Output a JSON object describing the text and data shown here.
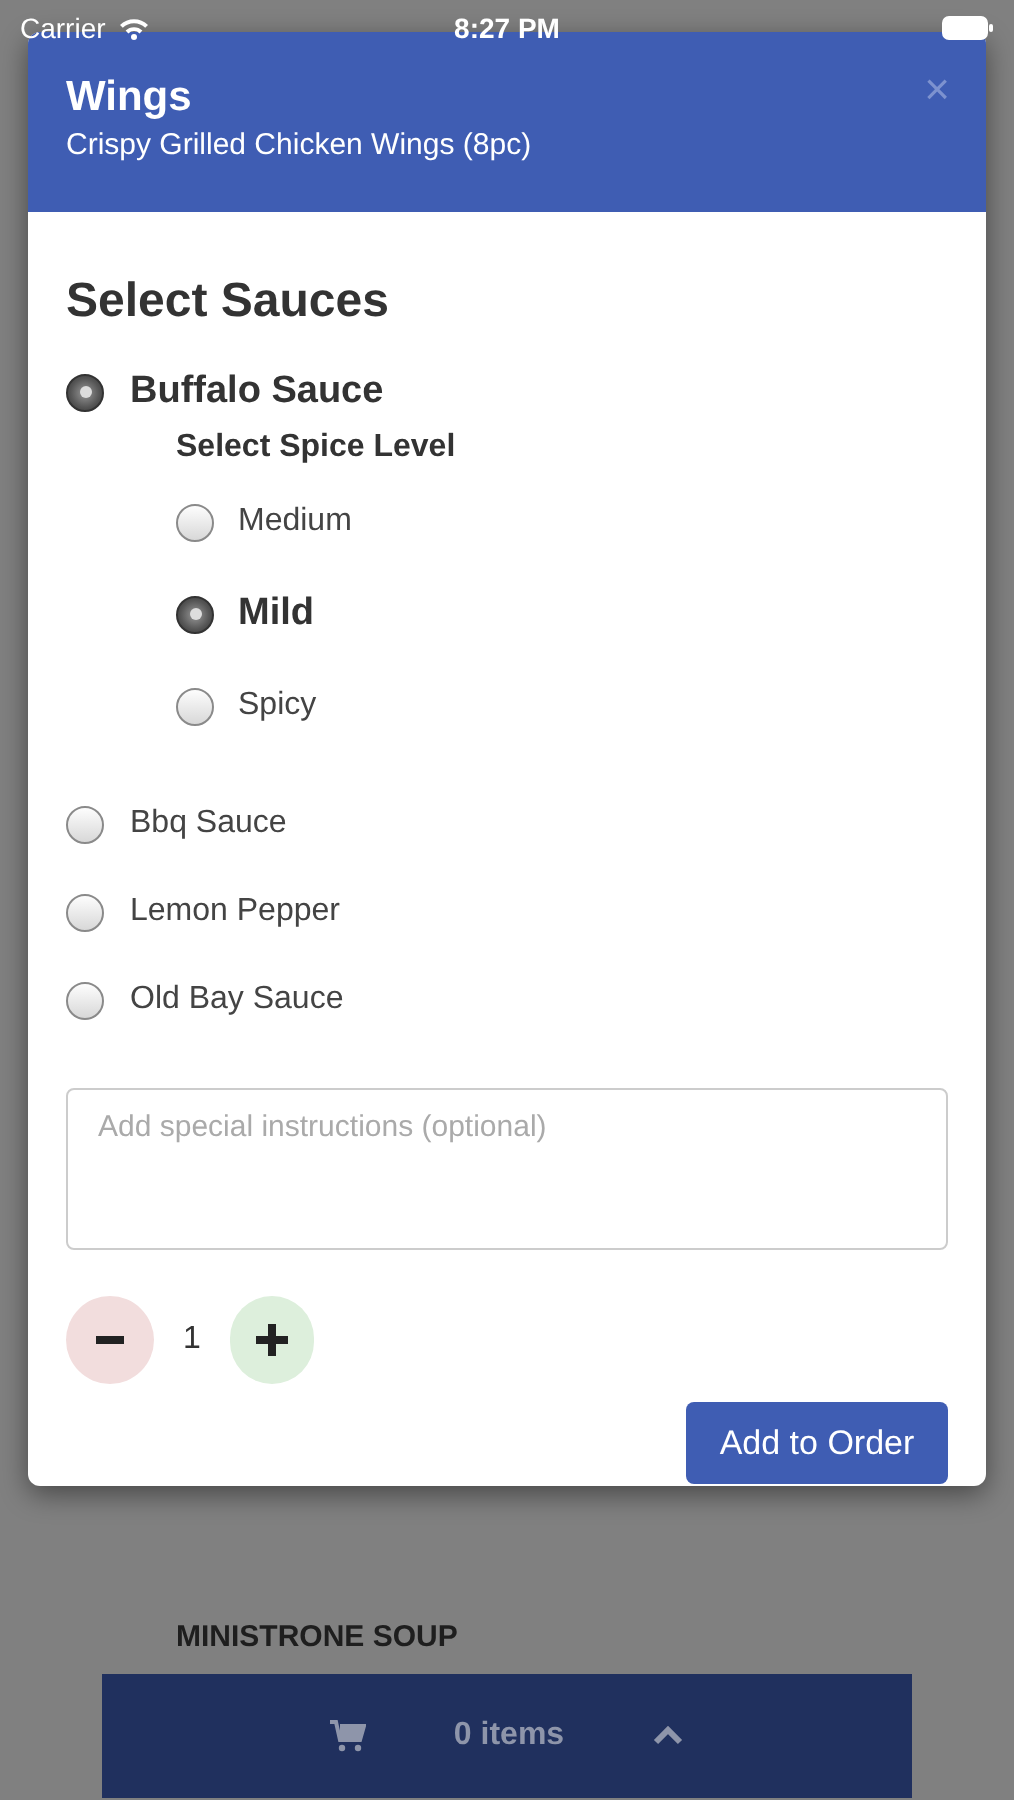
{
  "status_bar": {
    "carrier": "Carrier",
    "time": "8:27 PM"
  },
  "background": {
    "section_title": "MINISTRONE SOUP",
    "cart": {
      "count": "0 items"
    }
  },
  "modal": {
    "title": "Wings",
    "subtitle": "Crispy Grilled Chicken Wings (8pc)",
    "close": "×",
    "heading": "Select Sauces",
    "sauces": [
      {
        "label": "Buffalo Sauce",
        "selected": true,
        "sub_heading": "Select Spice Level",
        "options": [
          {
            "label": "Medium",
            "selected": false
          },
          {
            "label": "Mild",
            "selected": true
          },
          {
            "label": "Spicy",
            "selected": false
          }
        ]
      },
      {
        "label": "Bbq Sauce",
        "selected": false
      },
      {
        "label": "Lemon Pepper",
        "selected": false
      },
      {
        "label": "Old Bay Sauce",
        "selected": false
      }
    ],
    "instructions": {
      "placeholder": "Add special instructions (optional)"
    },
    "quantity": "1",
    "submit": "Add to Order"
  }
}
